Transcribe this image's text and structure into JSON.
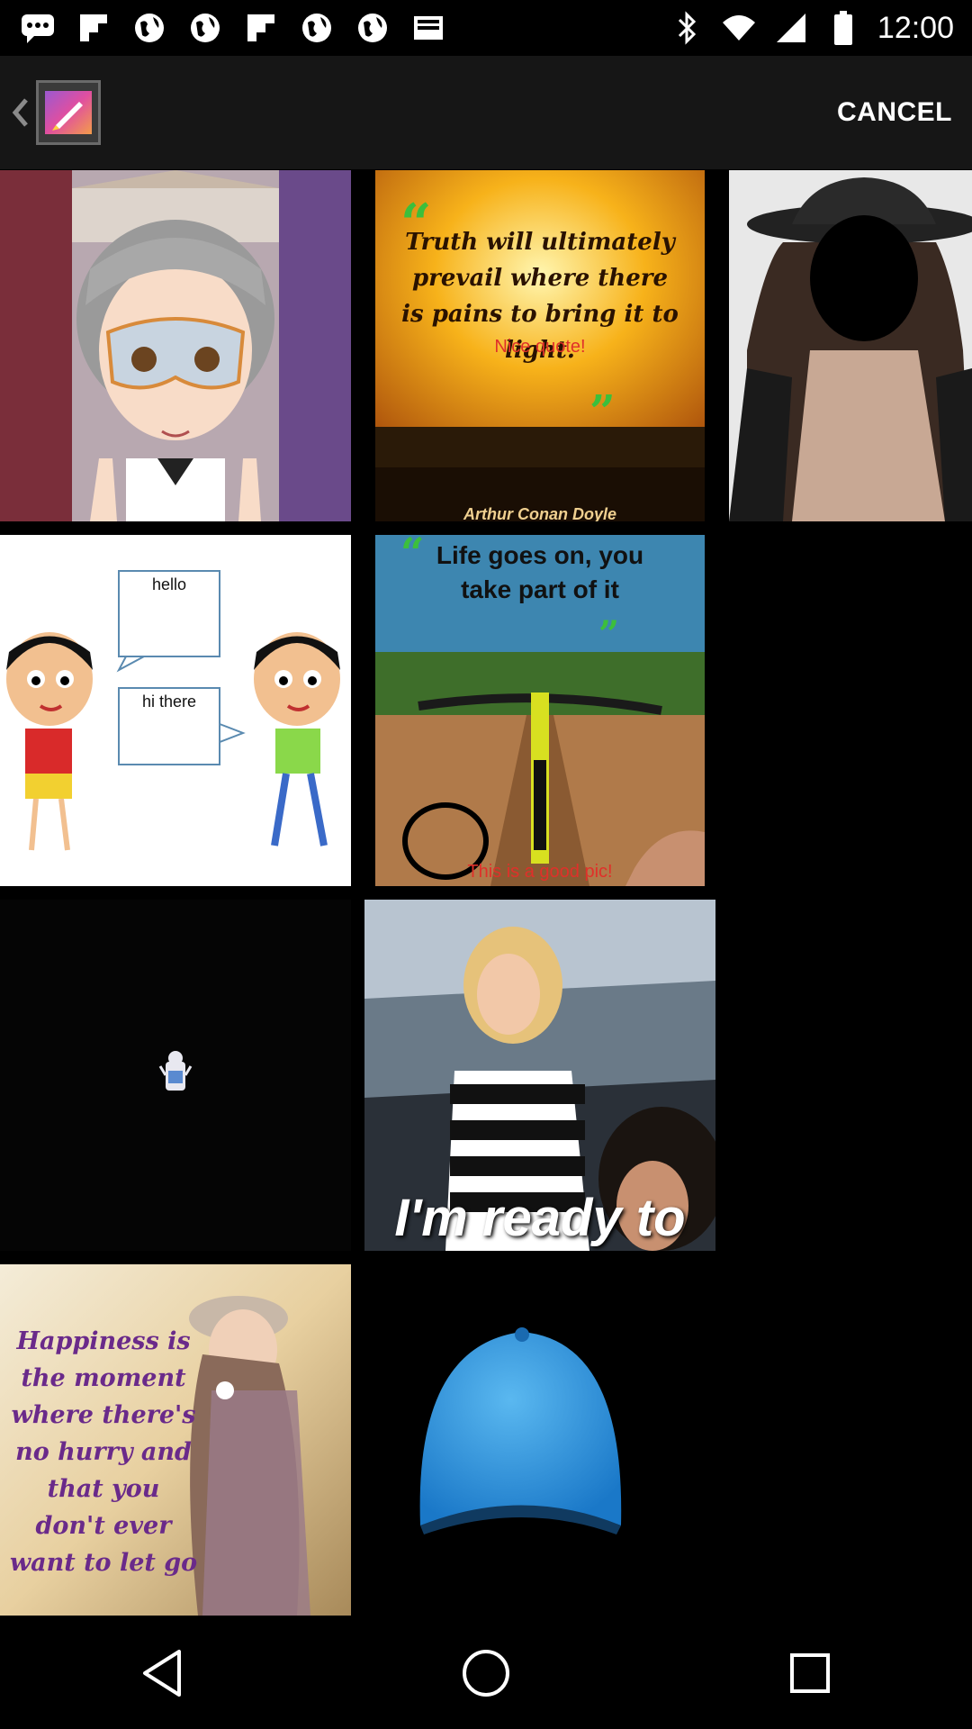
{
  "status_bar": {
    "time": "12:00",
    "left_icons": [
      "message-icon",
      "flipboard-icon",
      "globe-icon",
      "globe-icon",
      "flipboard-icon",
      "globe-icon",
      "globe-icon",
      "inbox-icon"
    ],
    "right_icons": [
      "bluetooth-icon",
      "wifi-icon",
      "signal-icon",
      "battery-icon"
    ]
  },
  "action_bar": {
    "back_icon": "back-chevron-icon",
    "app_icon": "gallery-icon",
    "cancel_label": "CANCEL"
  },
  "gallery": {
    "tiles": [
      {
        "name": "anime-masked-girl-image"
      },
      {
        "name": "truth-quote-image",
        "quote": "Truth will ultimately prevail where there is pains to bring it to light.",
        "overlay": "Nice quote!",
        "author": "Arthur Conan Doyle"
      },
      {
        "name": "masked-man-image"
      },
      {
        "name": "hello-cartoon-image",
        "bubble1": "hello",
        "bubble2": "hi there"
      },
      {
        "name": "bike-quote-image",
        "quote": "Life goes on, you take part of it",
        "overlay": "This is a good pic!"
      },
      {
        "name": "dark-figure-image"
      },
      {
        "name": "ready-girl-image",
        "caption": "I'm ready to"
      },
      {
        "name": "happiness-quote-image",
        "quote": "Happiness is the moment where there's no hurry and that you don't ever want to let go"
      },
      {
        "name": "blue-cap-image"
      }
    ]
  },
  "nav_bar": {
    "icons": [
      "back-nav-icon",
      "home-nav-icon",
      "recents-nav-icon"
    ]
  },
  "colors": {
    "background": "#000000",
    "action_bar": "#161616",
    "accent_green": "#3cbf3c",
    "overlay_red": "#e0302a"
  }
}
